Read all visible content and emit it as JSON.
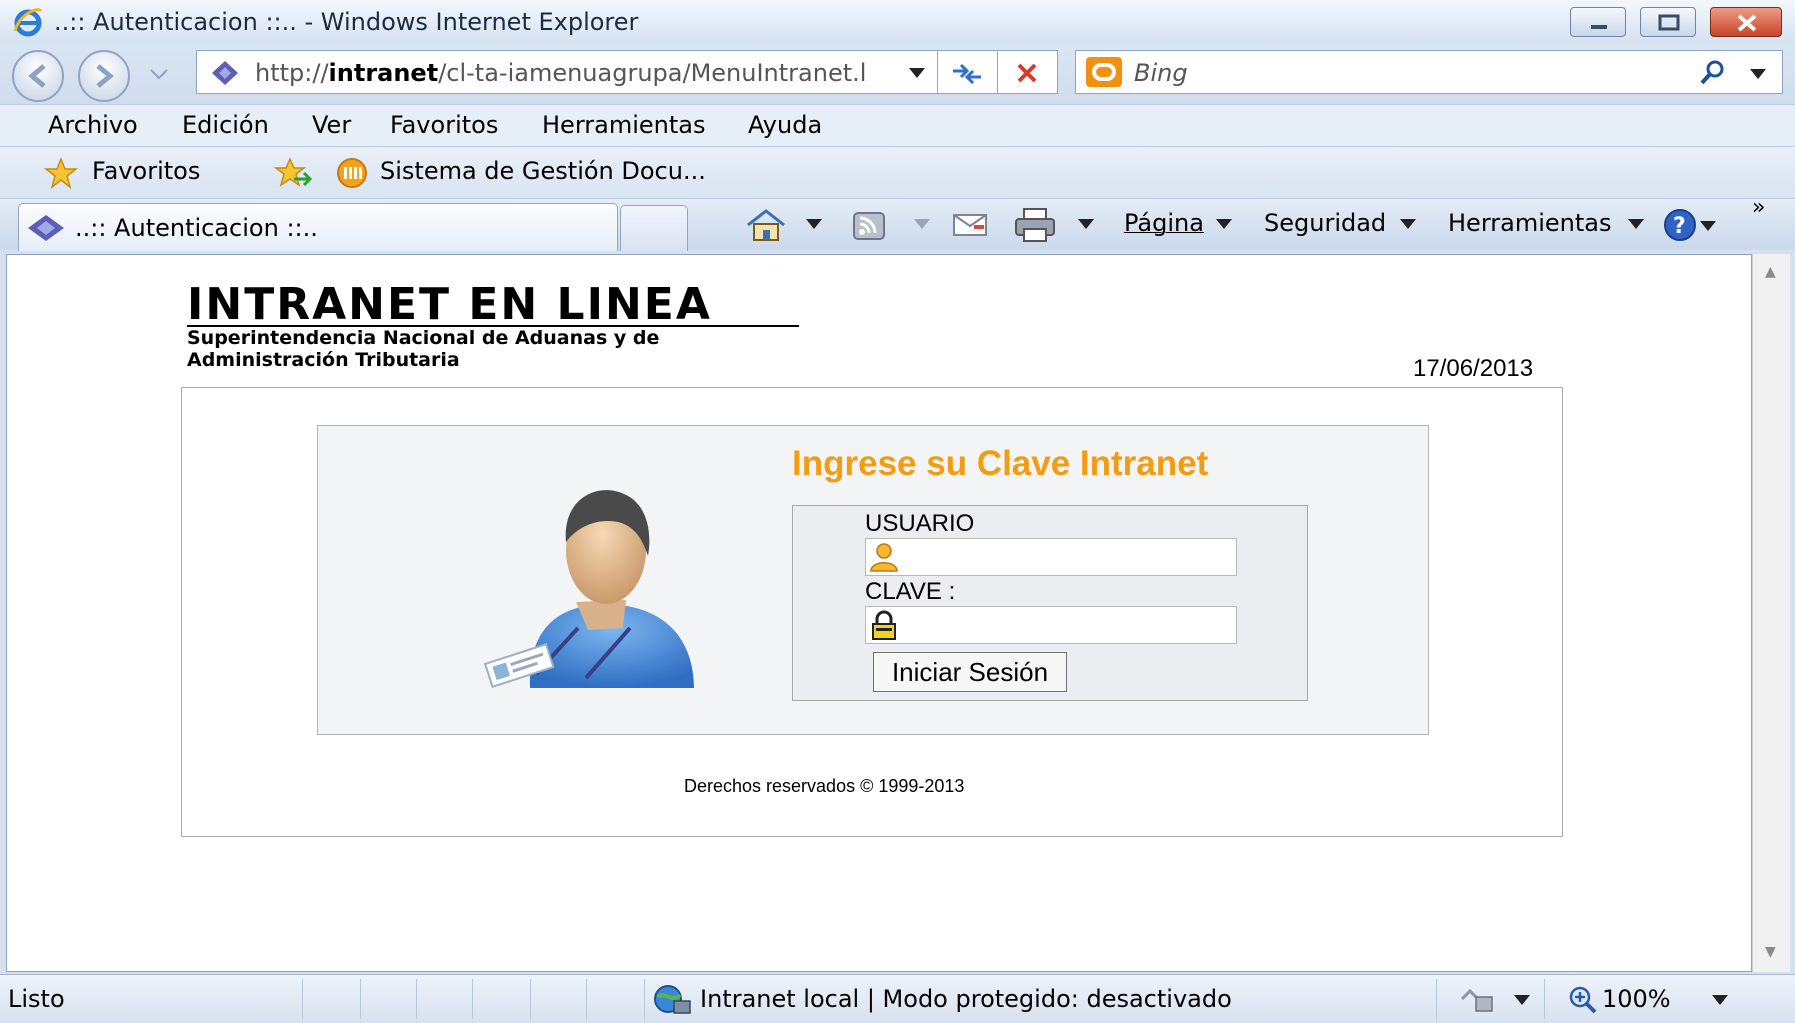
{
  "window": {
    "title": "..:: Autenticacion ::.. - Windows Internet Explorer"
  },
  "address_bar": {
    "url_prefix": "http://",
    "url_host": "intranet",
    "url_path": "/cl-ta-iamenuagrupa/MenuIntranet.l"
  },
  "search": {
    "placeholder": "Bing"
  },
  "menu": [
    "Archivo",
    "Edición",
    "Ver",
    "Favoritos",
    "Herramientas",
    "Ayuda"
  ],
  "favorites_bar": {
    "favorites_label": "Favoritos",
    "link_label": "Sistema de Gestión Docu..."
  },
  "tabs": {
    "active_title": "..:: Autenticacion ::.."
  },
  "command_bar": {
    "page": "Página",
    "security": "Seguridad",
    "tools": "Herramientas",
    "more": "»"
  },
  "page": {
    "brand_title": "INTRANET EN LINEA",
    "brand_sub1": "Superintendencia Nacional de Aduanas y de",
    "brand_sub2": "Administración Tributaria",
    "date": "17/06/2013",
    "heading": "Ingrese su Clave Intranet",
    "user_label": "USUARIO",
    "user_value": "",
    "pass_label": "CLAVE :",
    "pass_value": "",
    "login_button": "Iniciar Sesión",
    "copyright": "Derechos reservados © 1999-2013"
  },
  "status": {
    "left": "Listo",
    "zone": "Intranet local | Modo protegido: desactivado",
    "zoom": "100%"
  },
  "colors": {
    "heading_orange": "#f39c12",
    "ie_chrome": "#d6e1ef"
  }
}
